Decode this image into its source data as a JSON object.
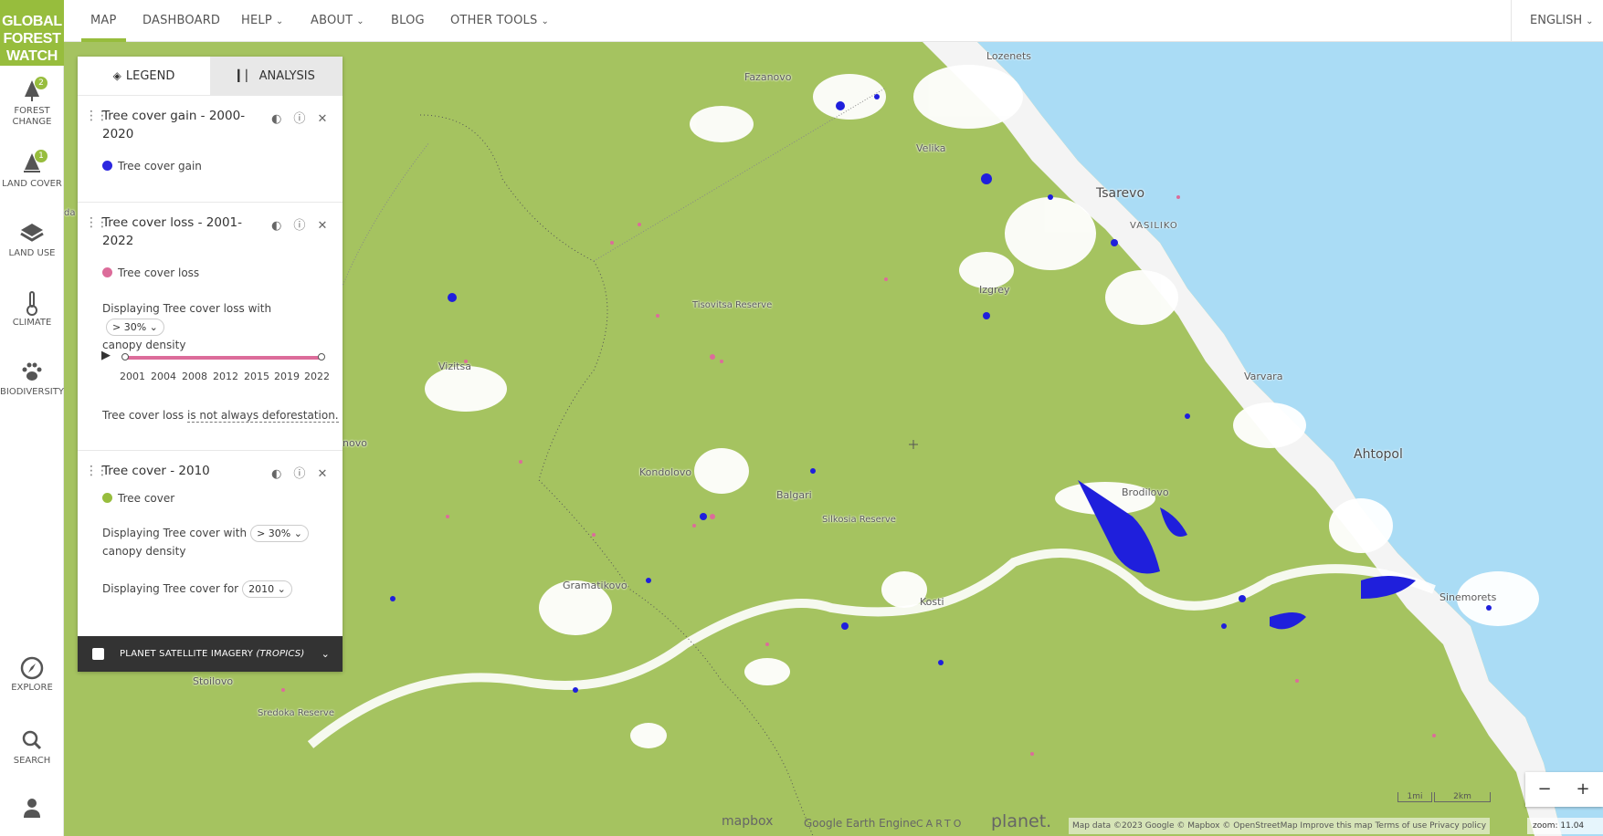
{
  "logo": {
    "line1": "GLOBAL",
    "line2": "FOREST",
    "line3": "WATCH"
  },
  "nav": {
    "items": [
      {
        "label": "MAP",
        "dropdown": false
      },
      {
        "label": "DASHBOARD",
        "dropdown": false
      },
      {
        "label": "HELP",
        "dropdown": true
      },
      {
        "label": "ABOUT",
        "dropdown": true
      },
      {
        "label": "BLOG",
        "dropdown": false
      },
      {
        "label": "OTHER TOOLS",
        "dropdown": true
      }
    ],
    "language": "ENGLISH"
  },
  "sidebar": {
    "items": [
      {
        "label1": "FOREST",
        "label2": "CHANGE",
        "badge": "2"
      },
      {
        "label1": "LAND COVER",
        "label2": "",
        "badge": "1"
      },
      {
        "label1": "LAND USE",
        "label2": "",
        "badge": ""
      },
      {
        "label1": "CLIMATE",
        "label2": "",
        "badge": ""
      },
      {
        "label1": "BIODIVERSITY",
        "label2": "",
        "badge": ""
      }
    ],
    "bottom": [
      {
        "label": "EXPLORE"
      },
      {
        "label": "SEARCH"
      }
    ]
  },
  "panel": {
    "tabs": {
      "legend": "LEGEND",
      "analysis": "ANALYSIS"
    },
    "layers": [
      {
        "title1": "Tree cover gain - 2000-",
        "title2": "2020",
        "legend": "Tree cover gain",
        "color": "#2c27e0"
      },
      {
        "title1": "Tree cover loss - 2001-",
        "title2": "2022",
        "legend": "Tree cover loss",
        "color": "#dc6c9a",
        "density_text1": "Displaying Tree cover loss with",
        "density_value": "> 30%",
        "density_text2": "canopy density",
        "years": [
          "2001",
          "2004",
          "2008",
          "2012",
          "2015",
          "2019",
          "2022"
        ],
        "note_prefix": "Tree cover loss",
        "note_link": "is not always deforestation."
      },
      {
        "title1": "Tree cover - 2010",
        "legend": "Tree cover",
        "color": "#97bd3d",
        "density_text1": "Displaying Tree cover with",
        "density_value": "> 30%",
        "density_text2": "canopy density",
        "year_text": "Displaying Tree cover for",
        "year_value": "2010"
      }
    ],
    "planet": {
      "label": "PLANET SATELLITE IMAGERY",
      "suffix": "(TROPICS)"
    }
  },
  "map": {
    "labels": [
      {
        "text": "Lozenets",
        "kind": "town"
      },
      {
        "text": "Fazanovo",
        "kind": "town"
      },
      {
        "text": "Velika",
        "kind": "town"
      },
      {
        "text": "Tsarevo",
        "kind": "big"
      },
      {
        "text": "VASILIKO",
        "kind": "small"
      },
      {
        "text": "Izgrey",
        "kind": "town"
      },
      {
        "text": "Tisovitsa Reserve",
        "kind": "small"
      },
      {
        "text": "Vizitsa",
        "kind": "town"
      },
      {
        "text": "Varvara",
        "kind": "town"
      },
      {
        "text": "Ahtopol",
        "kind": "big"
      },
      {
        "text": "Brodilovo",
        "kind": "town"
      },
      {
        "text": "Kondolovo",
        "kind": "town"
      },
      {
        "text": "Balgari",
        "kind": "town"
      },
      {
        "text": "Silkosia Reserve",
        "kind": "small"
      },
      {
        "text": "Gramatikovo",
        "kind": "town"
      },
      {
        "text": "Kosti",
        "kind": "town"
      },
      {
        "text": "Sinemorets",
        "kind": "town"
      },
      {
        "text": "Stoilovo",
        "kind": "town"
      },
      {
        "text": "Sredoka Reserve",
        "kind": "small"
      },
      {
        "text": "novo",
        "kind": "town"
      },
      {
        "text": "da",
        "kind": "small"
      }
    ],
    "scale": {
      "mi": "1mi",
      "km": "2km"
    },
    "credits": {
      "mapbox": "mapbox",
      "gee": "Google Earth Engine",
      "carto": "CARTO",
      "planet": "planet."
    },
    "attribution": "Map data ©2023 Google  © Mapbox  © OpenStreetMap  Improve this map  Terms of use  Privacy policy",
    "zoom_level": "zoom: 11.04",
    "zoom_out": "−",
    "zoom_in": "+"
  },
  "colors": {
    "forest": "#a5c360",
    "sea": "#aadcf5",
    "gain": "#1f1fdc",
    "loss": "#dc6c9a",
    "accent": "#97bd3d"
  }
}
